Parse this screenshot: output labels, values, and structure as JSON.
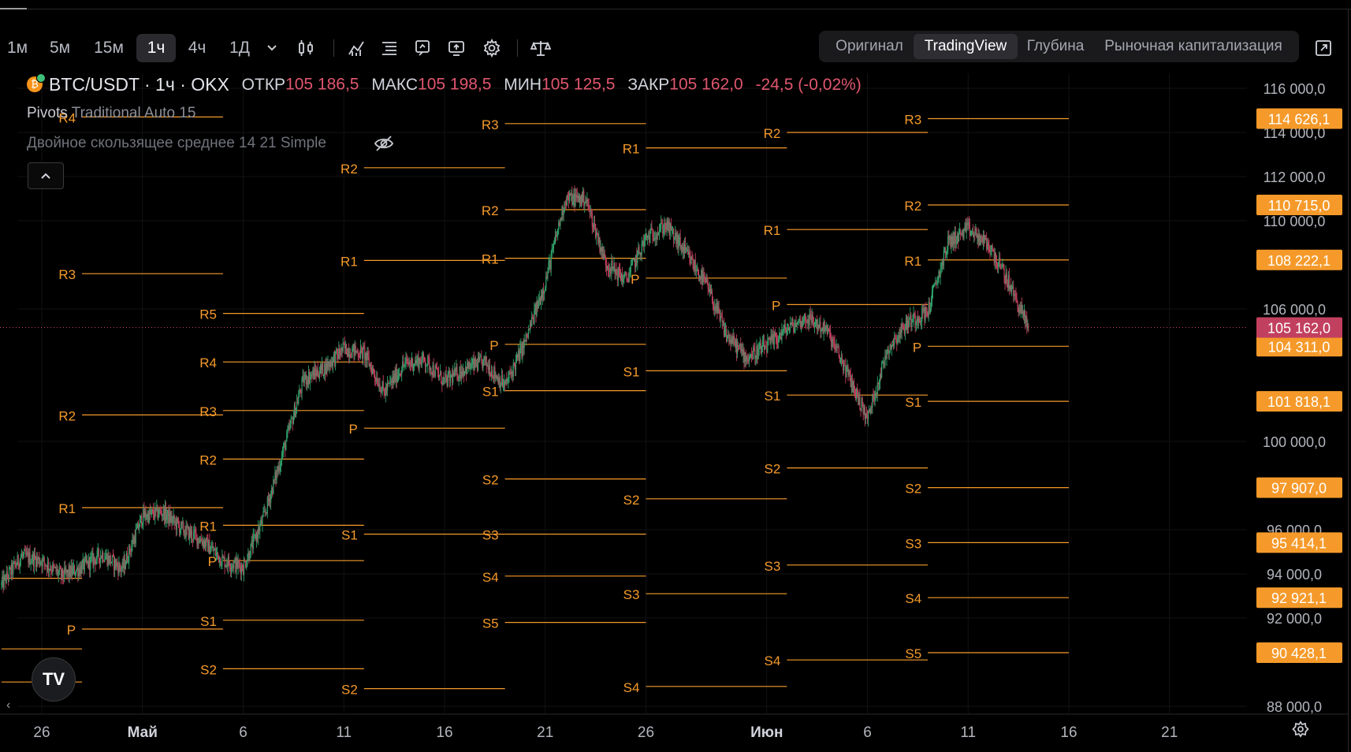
{
  "toolbar": {
    "timeframes": [
      {
        "label": "1м",
        "active": false
      },
      {
        "label": "5м",
        "active": false
      },
      {
        "label": "15м",
        "active": false
      },
      {
        "label": "1ч",
        "active": true
      },
      {
        "label": "4ч",
        "active": false
      },
      {
        "label": "1Д",
        "active": false
      }
    ],
    "icons": [
      "chevron-down-icon",
      "candles-icon",
      "indicators-icon",
      "layout-icon",
      "alert-icon",
      "replay-icon",
      "settings-icon",
      "compare-icon"
    ],
    "view_modes": [
      {
        "label": "Оригинал",
        "active": false
      },
      {
        "label": "TradingView",
        "active": true
      },
      {
        "label": "Глубина",
        "active": false
      },
      {
        "label": "Рыночная капитализация",
        "active": false
      }
    ],
    "expand_icon": "expand-icon"
  },
  "legend": {
    "symbol": "BTC/USDT · 1ч · OKX",
    "open_label": "ОТКР",
    "open": "105 186,5",
    "high_label": "МАКС",
    "high": "105 198,5",
    "low_label": "МИН",
    "low": "105 125,5",
    "close_label": "ЗАКР",
    "close": "105 162,0",
    "change": "-24,5 (-0,02%)",
    "indicator1_name": "Pivots",
    "indicator1_params": "Traditional Auto 15",
    "indicator2": "Двойное скользящее среднее 14 21 Simple"
  },
  "colors": {
    "pivot": "#f59a2a",
    "up": "#2fa36a",
    "down": "#c2405f",
    "price_label": "#c2405f",
    "pivot_label": "#f59a2a"
  },
  "chart_data": {
    "type": "candlestick",
    "title": "BTC/USDT · 1ч · OKX",
    "x_axis": {
      "ticks": [
        {
          "date": "2025-04-26",
          "label": "26"
        },
        {
          "date": "2025-05-01",
          "label": "Май"
        },
        {
          "date": "2025-05-06",
          "label": "6"
        },
        {
          "date": "2025-05-11",
          "label": "11"
        },
        {
          "date": "2025-05-16",
          "label": "16"
        },
        {
          "date": "2025-05-21",
          "label": "21"
        },
        {
          "date": "2025-05-26",
          "label": "26"
        },
        {
          "date": "2025-06-01",
          "label": "Июн"
        },
        {
          "date": "2025-06-06",
          "label": "6"
        },
        {
          "date": "2025-06-11",
          "label": "11"
        },
        {
          "date": "2025-06-16",
          "label": "16"
        },
        {
          "date": "2025-06-21",
          "label": "21"
        }
      ],
      "range": [
        "2025-04-24",
        "2025-06-25"
      ]
    },
    "y_axis": {
      "range": [
        87800,
        117200
      ],
      "ticks": [
        {
          "value": 116000,
          "label": "116 000,0"
        },
        {
          "value": 114000,
          "label": "114 000,0"
        },
        {
          "value": 112000,
          "label": "112 000,0"
        },
        {
          "value": 110000,
          "label": "110 000,0"
        },
        {
          "value": 106000,
          "label": "106 000,0"
        },
        {
          "value": 100000,
          "label": "100 000,0"
        },
        {
          "value": 96000,
          "label": "96 000,0"
        },
        {
          "value": 94000,
          "label": "94 000,0"
        },
        {
          "value": 92000,
          "label": "92 000,0"
        },
        {
          "value": 88000,
          "label": "88 000,0"
        }
      ]
    },
    "price_anchors": [
      [
        "2025-04-24",
        93500
      ],
      [
        "2025-04-25",
        94800
      ],
      [
        "2025-04-26",
        94600
      ],
      [
        "2025-04-27",
        93900
      ],
      [
        "2025-04-28",
        94300
      ],
      [
        "2025-04-29",
        94900
      ],
      [
        "2025-04-30",
        94200
      ],
      [
        "2025-05-01",
        96600
      ],
      [
        "2025-05-02",
        96800
      ],
      [
        "2025-05-03",
        96000
      ],
      [
        "2025-05-04",
        95500
      ],
      [
        "2025-05-05",
        94600
      ],
      [
        "2025-05-06",
        94300
      ],
      [
        "2025-05-07",
        96500
      ],
      [
        "2025-05-08",
        99600
      ],
      [
        "2025-05-09",
        102800
      ],
      [
        "2025-05-10",
        103300
      ],
      [
        "2025-05-11",
        104200
      ],
      [
        "2025-05-12",
        104000
      ],
      [
        "2025-05-13",
        102200
      ],
      [
        "2025-05-14",
        103500
      ],
      [
        "2025-05-15",
        103700
      ],
      [
        "2025-05-16",
        102700
      ],
      [
        "2025-05-17",
        103300
      ],
      [
        "2025-05-18",
        103600
      ],
      [
        "2025-05-19",
        102500
      ],
      [
        "2025-05-20",
        104500
      ],
      [
        "2025-05-21",
        107200
      ],
      [
        "2025-05-22",
        111000
      ],
      [
        "2025-05-23",
        111000
      ],
      [
        "2025-05-24",
        108100
      ],
      [
        "2025-05-25",
        107300
      ],
      [
        "2025-05-26",
        109200
      ],
      [
        "2025-05-27",
        109800
      ],
      [
        "2025-05-28",
        108500
      ],
      [
        "2025-05-29",
        107100
      ],
      [
        "2025-05-30",
        104800
      ],
      [
        "2025-05-31",
        103800
      ],
      [
        "2025-06-01",
        104300
      ],
      [
        "2025-06-02",
        105100
      ],
      [
        "2025-06-03",
        105600
      ],
      [
        "2025-06-04",
        105000
      ],
      [
        "2025-06-05",
        103100
      ],
      [
        "2025-06-06",
        101000
      ],
      [
        "2025-06-07",
        104200
      ],
      [
        "2025-06-08",
        105400
      ],
      [
        "2025-06-09",
        105900
      ],
      [
        "2025-06-10",
        109000
      ],
      [
        "2025-06-11",
        109600
      ],
      [
        "2025-06-12",
        108900
      ],
      [
        "2025-06-13",
        107200
      ],
      [
        "2025-06-14",
        105162
      ]
    ],
    "last_price": {
      "value": 105162,
      "label": "105 162,0"
    },
    "pivot_price_labels": [
      {
        "value": 114626.1,
        "label": "114 626,1"
      },
      {
        "value": 110715.0,
        "label": "110 715,0"
      },
      {
        "value": 108222.1,
        "label": "108 222,1"
      },
      {
        "value": 104311.0,
        "label": "104 311,0"
      },
      {
        "value": 101818.1,
        "label": "101 818,1"
      },
      {
        "value": 97907.0,
        "label": "97 907,0"
      },
      {
        "value": 95414.1,
        "label": "95 414,1"
      },
      {
        "value": 92921.1,
        "label": "92 921,1"
      },
      {
        "value": 90428.1,
        "label": "90 428,1"
      }
    ],
    "pivot_periods": [
      {
        "start": "2025-04-24",
        "end": "2025-04-28",
        "levels": [
          {
            "name": "P",
            "value": 93800
          },
          {
            "name": "S1",
            "value": 90600
          },
          {
            "name": "S2",
            "value": 89100
          }
        ]
      },
      {
        "start": "2025-04-28",
        "end": "2025-05-05",
        "levels": [
          {
            "name": "R4",
            "value": 114700
          },
          {
            "name": "R3",
            "value": 107600
          },
          {
            "name": "R2",
            "value": 101200
          },
          {
            "name": "R1",
            "value": 97000
          },
          {
            "name": "P",
            "value": 91500
          }
        ]
      },
      {
        "start": "2025-05-05",
        "end": "2025-05-12",
        "levels": [
          {
            "name": "R5",
            "value": 105800
          },
          {
            "name": "R4",
            "value": 103600
          },
          {
            "name": "R3",
            "value": 101400
          },
          {
            "name": "R2",
            "value": 99200
          },
          {
            "name": "R1",
            "value": 96200
          },
          {
            "name": "P",
            "value": 94600
          },
          {
            "name": "S1",
            "value": 91900
          },
          {
            "name": "S2",
            "value": 89700
          }
        ]
      },
      {
        "start": "2025-05-12",
        "end": "2025-05-19",
        "levels": [
          {
            "name": "R2",
            "value": 112400
          },
          {
            "name": "R1",
            "value": 108200
          },
          {
            "name": "P",
            "value": 100600
          },
          {
            "name": "S1",
            "value": 95800
          },
          {
            "name": "S2",
            "value": 88800
          }
        ]
      },
      {
        "start": "2025-05-19",
        "end": "2025-05-26",
        "levels": [
          {
            "name": "R3",
            "value": 114400
          },
          {
            "name": "R2",
            "value": 110500
          },
          {
            "name": "R1",
            "value": 108300
          },
          {
            "name": "P",
            "value": 104400
          },
          {
            "name": "S1",
            "value": 102300
          },
          {
            "name": "S2",
            "value": 98300
          },
          {
            "name": "S3",
            "value": 95800
          },
          {
            "name": "S4",
            "value": 93900
          },
          {
            "name": "S5",
            "value": 91800
          }
        ]
      },
      {
        "start": "2025-05-26",
        "end": "2025-06-02",
        "levels": [
          {
            "name": "R1",
            "value": 113300
          },
          {
            "name": "P",
            "value": 107400
          },
          {
            "name": "S1",
            "value": 103200
          },
          {
            "name": "S2",
            "value": 97400
          },
          {
            "name": "S3",
            "value": 93100
          },
          {
            "name": "S4",
            "value": 88900
          }
        ]
      },
      {
        "start": "2025-06-02",
        "end": "2025-06-09",
        "levels": [
          {
            "name": "R2",
            "value": 114000
          },
          {
            "name": "R1",
            "value": 109600
          },
          {
            "name": "P",
            "value": 106200
          },
          {
            "name": "S1",
            "value": 102100
          },
          {
            "name": "S2",
            "value": 98800
          },
          {
            "name": "S3",
            "value": 94400
          },
          {
            "name": "S4",
            "value": 90100
          }
        ]
      },
      {
        "start": "2025-06-09",
        "end": "2025-06-16",
        "levels": [
          {
            "name": "R3",
            "value": 114626.1
          },
          {
            "name": "R2",
            "value": 110715.0
          },
          {
            "name": "R1",
            "value": 108222.1
          },
          {
            "name": "P",
            "value": 104311.0
          },
          {
            "name": "S1",
            "value": 101818.1
          },
          {
            "name": "S2",
            "value": 97907.0
          },
          {
            "name": "S3",
            "value": 95414.1
          },
          {
            "name": "S4",
            "value": 92921.1
          },
          {
            "name": "S5",
            "value": 90428.1
          }
        ]
      }
    ]
  }
}
